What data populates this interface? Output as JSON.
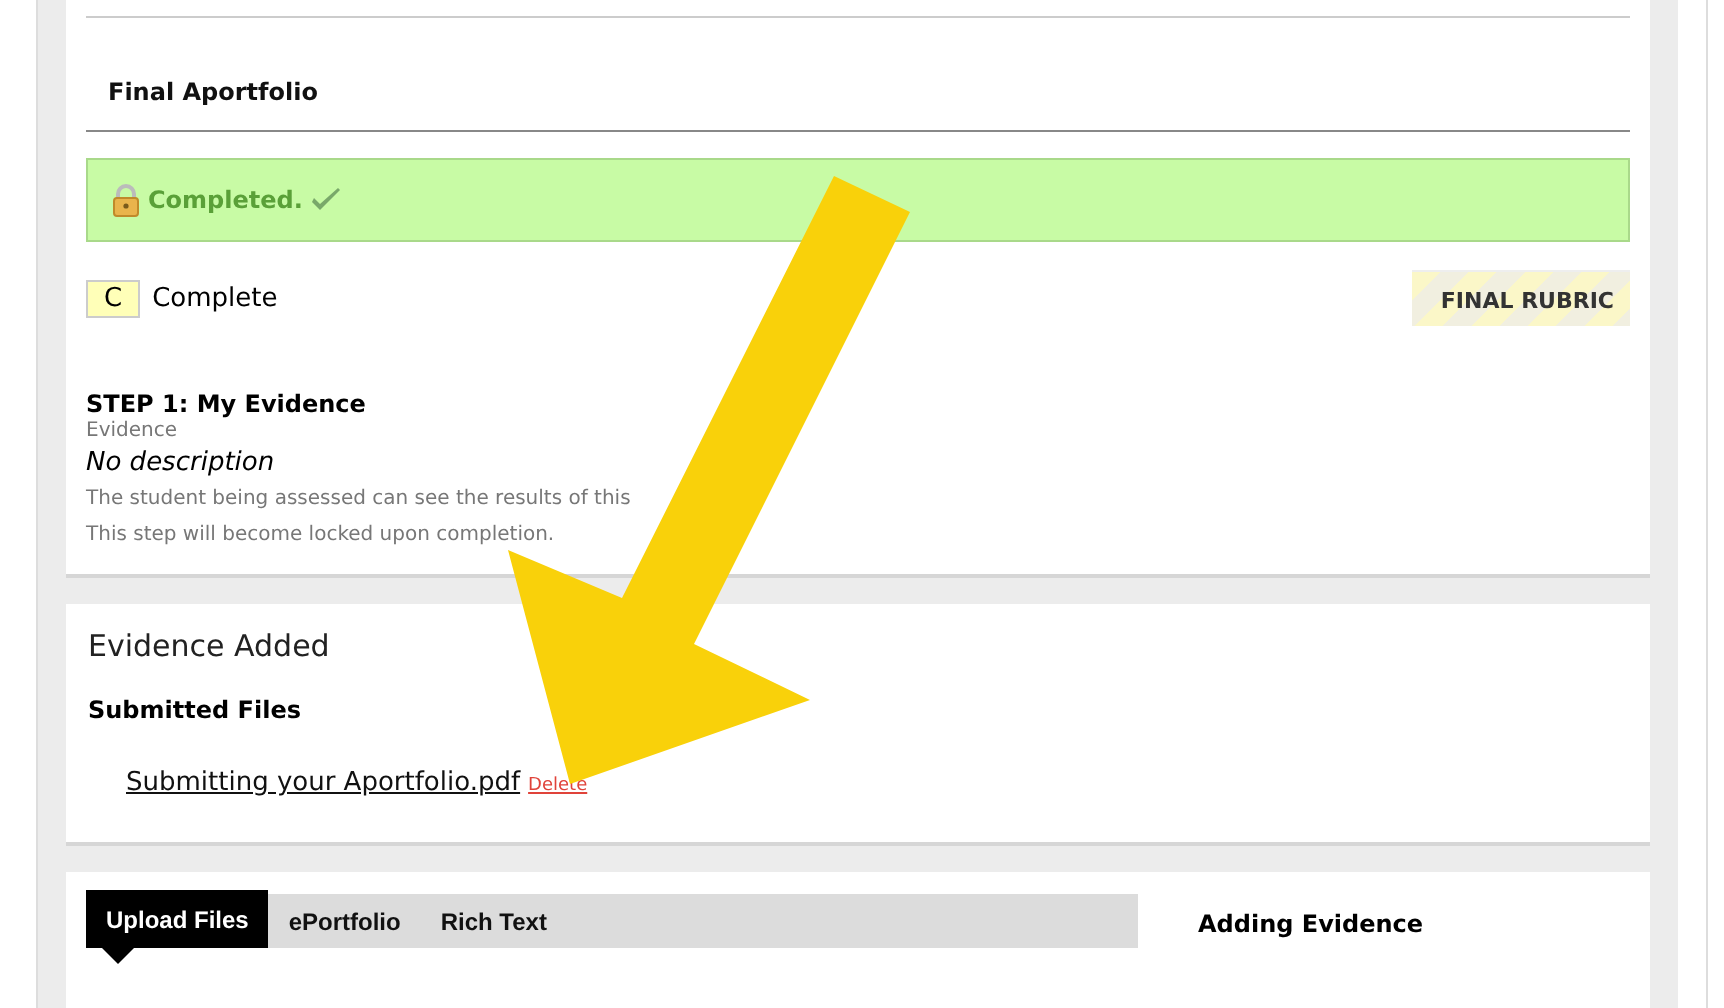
{
  "assessment": {
    "title": "Final Aportfolio",
    "status": {
      "label": "Completed.",
      "locked": true,
      "complete": true
    },
    "grade": {
      "letter": "C",
      "label": "Complete"
    },
    "rubric_button": "FINAL RUBRIC"
  },
  "step": {
    "title": "STEP 1: My Evidence",
    "type": "Evidence",
    "description": "No description",
    "notes": [
      "The student being assessed can see the results of this",
      "This step will become locked upon completion."
    ]
  },
  "evidence": {
    "title": "Evidence Added",
    "section": "Submitted Files",
    "files": [
      {
        "name": "Submitting your Aportfolio.pdf",
        "action": "Delete"
      }
    ]
  },
  "upload": {
    "tabs": [
      {
        "label": "Upload Files",
        "selected": true
      },
      {
        "label": "ePortfolio",
        "selected": false
      },
      {
        "label": "Rich Text",
        "selected": false
      }
    ],
    "side_title": "Adding Evidence"
  },
  "annotation": {
    "kind": "arrow",
    "color": "#f9d10a"
  }
}
